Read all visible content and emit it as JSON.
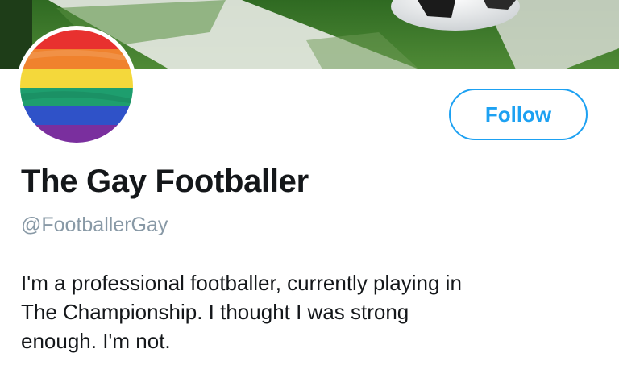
{
  "profile": {
    "display_name": "The Gay Footballer",
    "handle": "@FootballerGay",
    "bio_lines": [
      "I'm a professional footballer, currently playing in",
      "The Championship. I thought I was strong",
      "enough. I'm not."
    ],
    "follow_label": "Follow"
  },
  "banner": {
    "image": "soccer-ball-on-grass"
  },
  "avatar": {
    "image": "rainbow-pride-flag"
  },
  "colors": {
    "accent": "#1da1f2",
    "text": "#14171a",
    "muted": "#8899a6",
    "grass": "#3f7a2c"
  }
}
